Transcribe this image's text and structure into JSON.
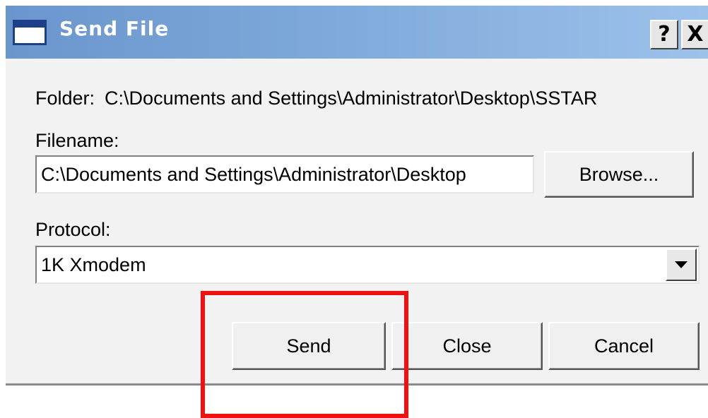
{
  "window": {
    "title": "Send File",
    "help_button": "?",
    "close_button": "X",
    "icon": "window-icon"
  },
  "form": {
    "folder_label": "Folder:",
    "folder_path": "C:\\Documents and Settings\\Administrator\\Desktop\\SSTAR",
    "filename_label": "Filename:",
    "filename_value": "C:\\Documents and Settings\\Administrator\\Desktop",
    "browse_label": "Browse...",
    "protocol_label": "Protocol:",
    "protocol_value": "1K Xmodem"
  },
  "buttons": {
    "send": "Send",
    "close": "Close",
    "cancel": "Cancel"
  },
  "colors": {
    "titlebar_start": "#6a96ce",
    "titlebar_end": "#9cc2ea",
    "highlight": "#ee1111"
  }
}
